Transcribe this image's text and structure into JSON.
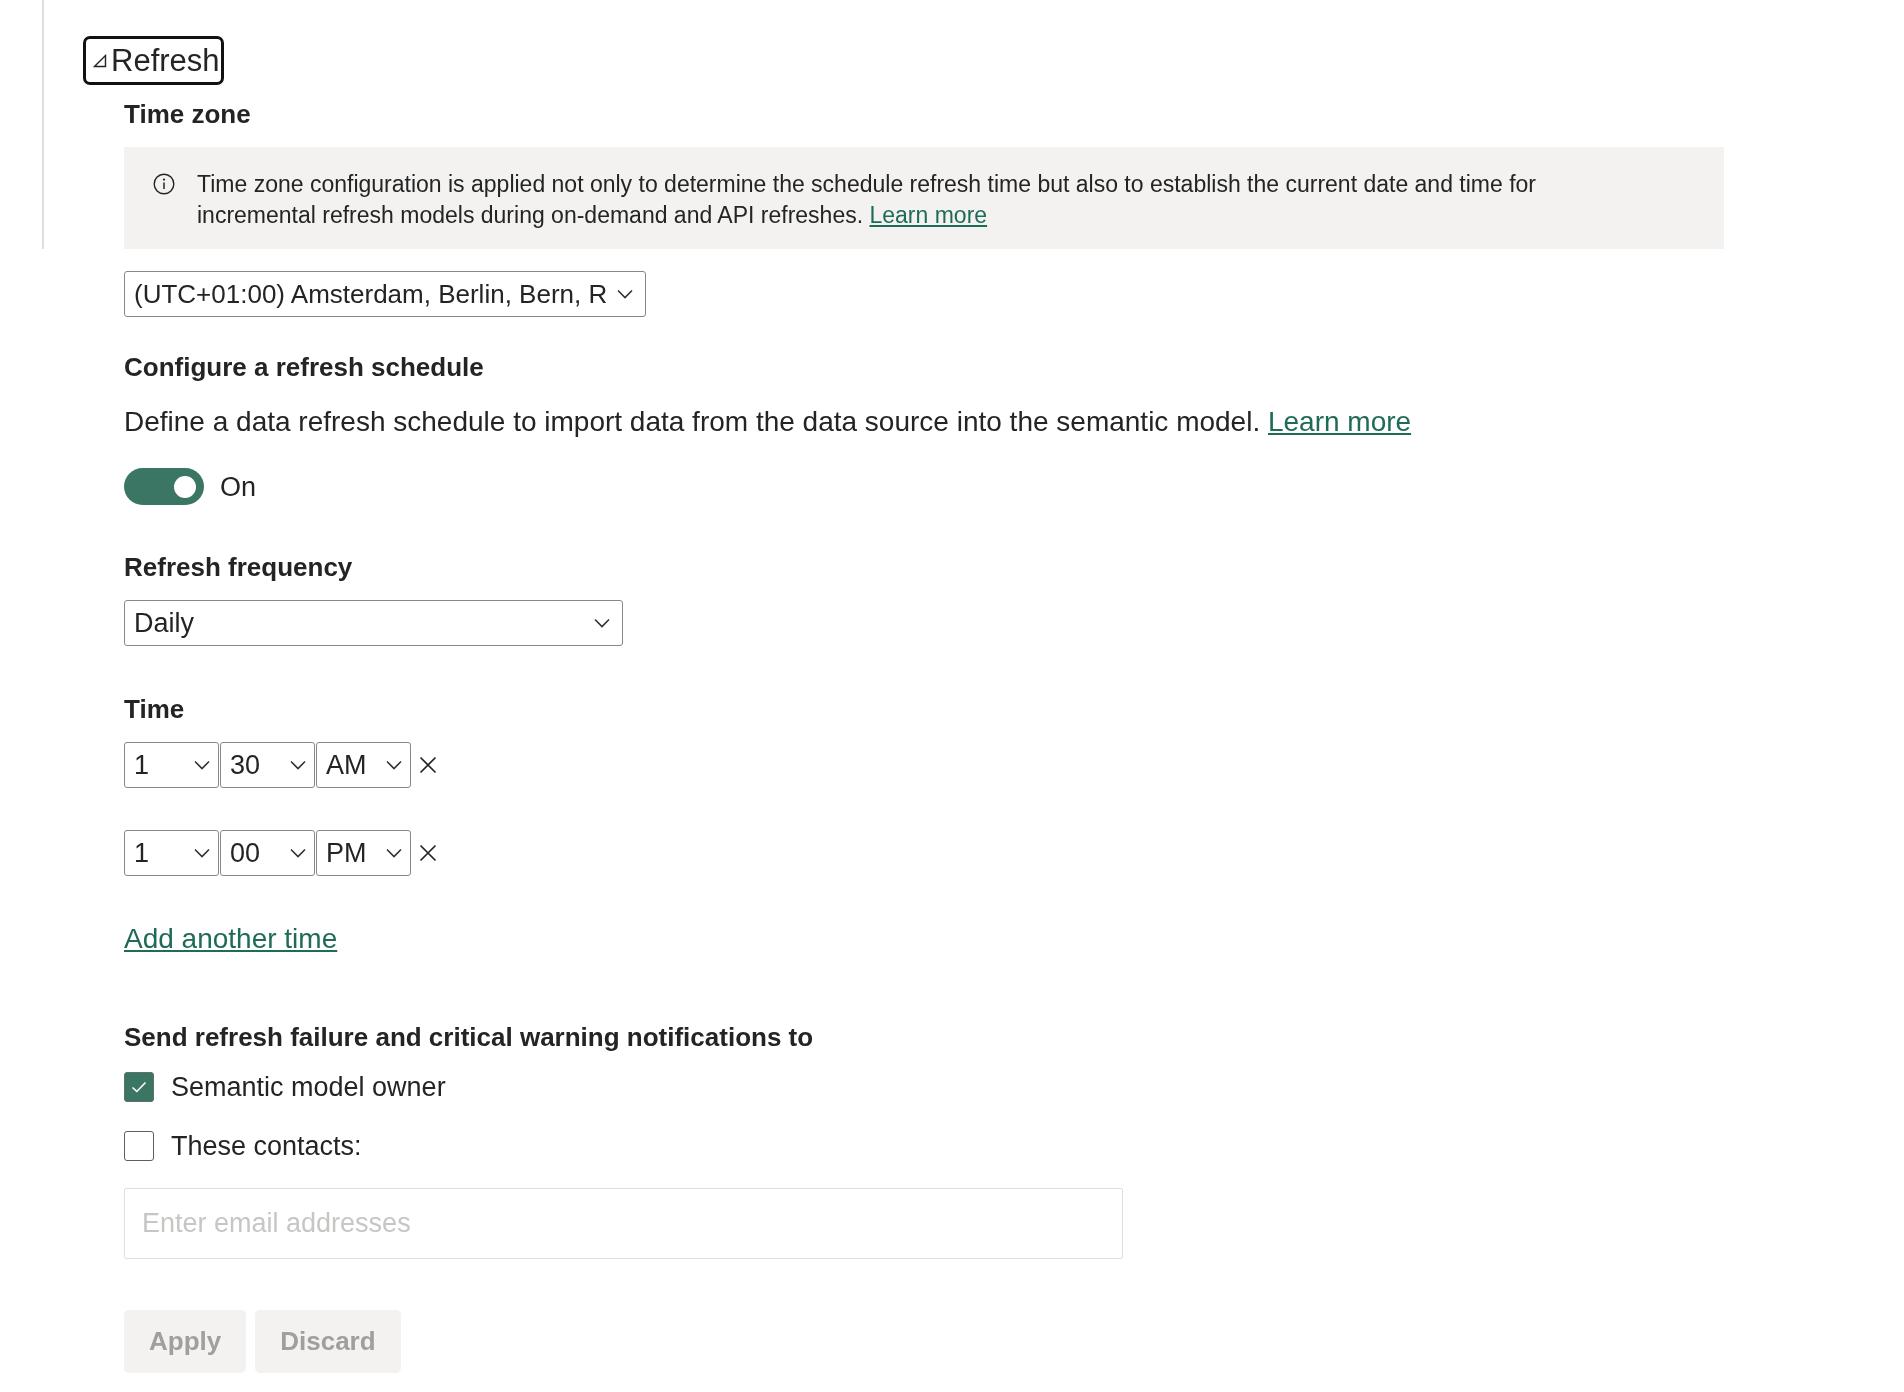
{
  "header": {
    "title": "Refresh"
  },
  "time_zone": {
    "heading": "Time zone",
    "info": {
      "text": "Time zone configuration is applied not only to determine the schedule refresh time but also to establish the current date and time for incremental refresh models during on-demand and API refreshes.",
      "link": "Learn more"
    },
    "value": "(UTC+01:00) Amsterdam, Berlin, Bern, R"
  },
  "schedule": {
    "heading": "Configure a refresh schedule",
    "description": "Define a data refresh schedule to import data from the data source into the semantic model.",
    "link": "Learn more",
    "toggle": {
      "on": true,
      "label": "On"
    }
  },
  "frequency": {
    "label": "Refresh frequency",
    "value": "Daily"
  },
  "time": {
    "label": "Time",
    "rows": [
      {
        "hour": "1",
        "minute": "30",
        "period": "AM"
      },
      {
        "hour": "1",
        "minute": "00",
        "period": "PM"
      }
    ],
    "add_link": "Add another time"
  },
  "notifications": {
    "heading": "Send refresh failure and critical warning notifications to",
    "options": [
      {
        "label": "Semantic model owner",
        "checked": true
      },
      {
        "label": "These contacts:",
        "checked": false
      }
    ],
    "email": {
      "placeholder": "Enter email addresses"
    }
  },
  "buttons": [
    {
      "label": "Apply",
      "disabled": true
    },
    {
      "label": "Discard",
      "disabled": true
    }
  ]
}
